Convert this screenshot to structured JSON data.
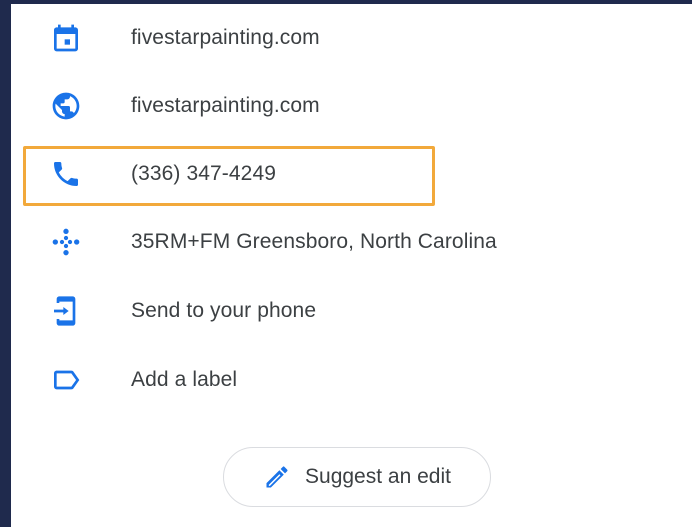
{
  "colors": {
    "accent": "#1a73e8",
    "text": "#3c4043",
    "highlight_border": "#f2a93b",
    "background_edge": "#1f2a4d"
  },
  "rows": [
    {
      "icon": "calendar-icon",
      "label": "fivestarpainting.com"
    },
    {
      "icon": "globe-icon",
      "label": "fivestarpainting.com"
    },
    {
      "icon": "phone-icon",
      "label": "(336) 347-4249"
    },
    {
      "icon": "plus-code-icon",
      "label": "35RM+FM Greensboro, North Carolina"
    },
    {
      "icon": "send-to-phone-icon",
      "label": "Send to your phone"
    },
    {
      "icon": "label-icon",
      "label": "Add a label"
    }
  ],
  "suggest_edit": {
    "icon": "pencil-icon",
    "label": "Suggest an edit"
  }
}
